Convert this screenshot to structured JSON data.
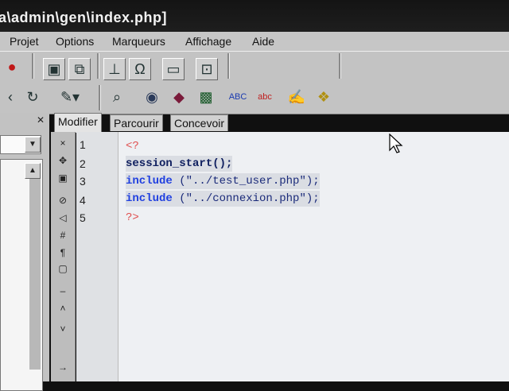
{
  "window": {
    "title": "a\\admin\\gen\\index.php]"
  },
  "menu": [
    "Projet",
    "Options",
    "Marqueurs",
    "Affichage",
    "Aide"
  ],
  "tabs": [
    "Modifier",
    "Parcourir",
    "Concevoir"
  ],
  "editor": {
    "line_numbers": [
      "1",
      "2",
      "3",
      "4",
      "5"
    ],
    "lines": [
      {
        "tokens": [
          {
            "t": "<?",
            "c": "php"
          }
        ]
      },
      {
        "tokens": [
          {
            "t": "session_start",
            "c": "fn"
          },
          {
            "t": "();",
            "c": "fn"
          }
        ]
      },
      {
        "tokens": [
          {
            "t": "include",
            "c": "kw"
          },
          {
            "t": " (\"../test_user.php\");",
            "c": "str"
          }
        ]
      },
      {
        "tokens": [
          {
            "t": "include",
            "c": "kw"
          },
          {
            "t": " (\"../connexion.php\");",
            "c": "str"
          }
        ]
      },
      {
        "tokens": [
          {
            "t": "?>",
            "c": "php"
          }
        ]
      }
    ]
  },
  "panel": {
    "close_glyph": "✕"
  },
  "icons": {
    "toolbar_row1": [
      "record-icon",
      "window-icon",
      "window-arrow-icon",
      "insert-line-icon",
      "omega-icon",
      "monitor-icon",
      "image-search-icon"
    ],
    "toolbar_row2": [
      "undo-icon",
      "redo-icon",
      "brush-icon",
      "magnifier-icon",
      "globe-icon",
      "component-icon",
      "image-icon",
      "spellcheck-icon",
      "spell-abc-icon",
      "edit-pen-icon",
      "gallery-icon"
    ],
    "side_strip": [
      "close-small-icon",
      "move-icon",
      "frame-icon",
      "unlink-icon",
      "speaker-icon",
      "hash-icon",
      "pilcrow-icon",
      "comment-icon",
      "line-icon",
      "arrow-up-icon",
      "arrow-down-icon",
      "arrow-right-icon"
    ]
  }
}
